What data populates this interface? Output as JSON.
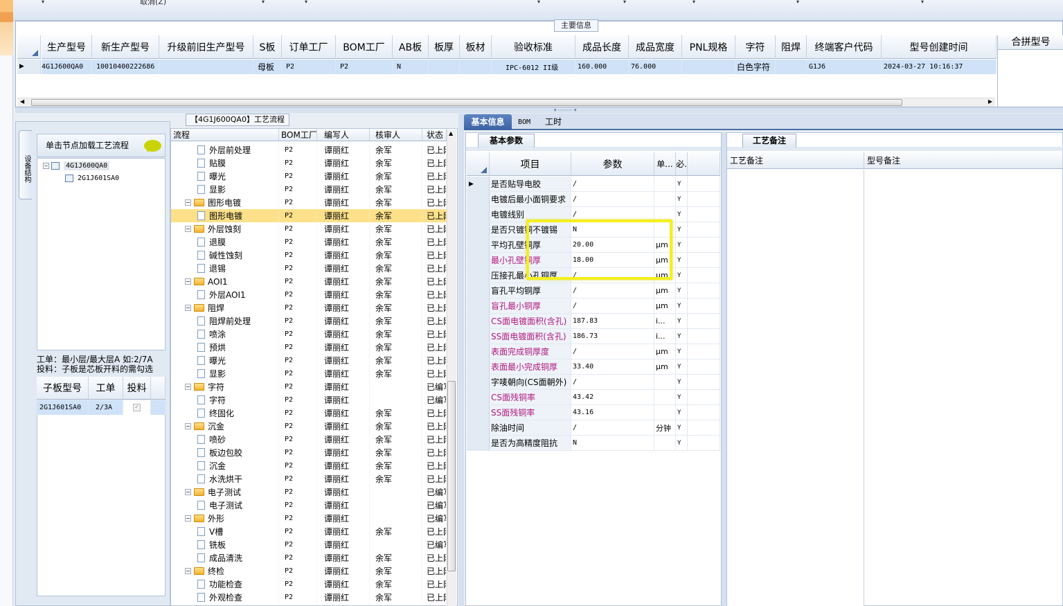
{
  "toolbar": {
    "cancel_label": "取消(Z)"
  },
  "main_info": {
    "title": "主要信息",
    "columns": [
      "生产型号",
      "新生产型号",
      "升级前旧生产型号",
      "S板",
      "订单工厂",
      "BOM工厂",
      "AB板",
      "板厚",
      "板材",
      "验收标准",
      "成品长度",
      "成品宽度",
      "PNL规格",
      "字符",
      "阻焊",
      "终端客户代码",
      "型号创建时间"
    ],
    "row": [
      "4G1J600QA0",
      "10010400222686",
      "",
      "母板",
      "P2",
      "P2",
      "N",
      "",
      "",
      "IPC-6012 II级",
      "160.000",
      "76.000",
      "",
      "白色字符",
      "",
      "G1J6",
      "2024-03-27 10:16:37"
    ],
    "merge_header": "合拼型号"
  },
  "structure": {
    "tab_label": "设备结构",
    "load_header": "单击节点加载工艺流程",
    "tree": [
      {
        "label": "4G1J600QA0",
        "level": 0
      },
      {
        "label": "2G1J601SA0",
        "level": 1
      }
    ],
    "hint_line1": "工单：最小层/最大层A 如:2/7A",
    "hint_line2": "投料：子板是芯板开料的需勾选",
    "sub_columns": [
      "子板型号",
      "工单",
      "投料"
    ],
    "sub_row": {
      "model": "2G1J601SA0",
      "order": "2/3A",
      "checked": "✓"
    }
  },
  "process": {
    "title": "【4G1J600QA0】工艺流程",
    "columns": [
      "流程",
      "BOM工厂",
      "编写人",
      "核审人",
      "状态"
    ],
    "rows": [
      {
        "level": 1,
        "type": "doc",
        "name": "外层前处理",
        "factory": "P2",
        "writer": "谭丽红",
        "reviewer": "余军",
        "status": "已上网"
      },
      {
        "level": 1,
        "type": "doc",
        "name": "贴膜",
        "factory": "P2",
        "writer": "谭丽红",
        "reviewer": "余军",
        "status": "已上网"
      },
      {
        "level": 1,
        "type": "doc",
        "name": "曝光",
        "factory": "P2",
        "writer": "谭丽红",
        "reviewer": "余军",
        "status": "已上网"
      },
      {
        "level": 1,
        "type": "doc",
        "name": "显影",
        "factory": "P2",
        "writer": "谭丽红",
        "reviewer": "余军",
        "status": "已上网"
      },
      {
        "level": 0,
        "type": "folder",
        "name": "图形电镀",
        "factory": "P2",
        "writer": "谭丽红",
        "reviewer": "余军",
        "status": "已上网"
      },
      {
        "level": 1,
        "type": "doc",
        "name": "图形电镀",
        "factory": "P2",
        "writer": "谭丽红",
        "reviewer": "余军",
        "status": "已上网",
        "selected": true
      },
      {
        "level": 0,
        "type": "folder",
        "name": "外层蚀刻",
        "factory": "P2",
        "writer": "谭丽红",
        "reviewer": "余军",
        "status": "已上网"
      },
      {
        "level": 1,
        "type": "doc",
        "name": "退膜",
        "factory": "P2",
        "writer": "谭丽红",
        "reviewer": "余军",
        "status": "已上网"
      },
      {
        "level": 1,
        "type": "doc",
        "name": "碱性蚀刻",
        "factory": "P2",
        "writer": "谭丽红",
        "reviewer": "余军",
        "status": "已上网"
      },
      {
        "level": 1,
        "type": "doc",
        "name": "退锡",
        "factory": "P2",
        "writer": "谭丽红",
        "reviewer": "余军",
        "status": "已上网"
      },
      {
        "level": 0,
        "type": "folder",
        "name": "AOI1",
        "factory": "P2",
        "writer": "谭丽红",
        "reviewer": "余军",
        "status": "已上网"
      },
      {
        "level": 1,
        "type": "doc",
        "name": "外层AOI1",
        "factory": "P2",
        "writer": "谭丽红",
        "reviewer": "余军",
        "status": "已上网"
      },
      {
        "level": 0,
        "type": "folder",
        "name": "阻焊",
        "factory": "P2",
        "writer": "谭丽红",
        "reviewer": "余军",
        "status": "已上网"
      },
      {
        "level": 1,
        "type": "doc",
        "name": "阻焊前处理",
        "factory": "P2",
        "writer": "谭丽红",
        "reviewer": "余军",
        "status": "已上网"
      },
      {
        "level": 1,
        "type": "doc",
        "name": "喷涂",
        "factory": "P2",
        "writer": "谭丽红",
        "reviewer": "余军",
        "status": "已上网"
      },
      {
        "level": 1,
        "type": "doc",
        "name": "预烘",
        "factory": "P2",
        "writer": "谭丽红",
        "reviewer": "余军",
        "status": "已上网"
      },
      {
        "level": 1,
        "type": "doc",
        "name": "曝光",
        "factory": "P2",
        "writer": "谭丽红",
        "reviewer": "余军",
        "status": "已上网"
      },
      {
        "level": 1,
        "type": "doc",
        "name": "显影",
        "factory": "P2",
        "writer": "谭丽红",
        "reviewer": "余军",
        "status": "已上网"
      },
      {
        "level": 0,
        "type": "folder",
        "name": "字符",
        "factory": "P2",
        "writer": "谭丽红",
        "reviewer": "",
        "status": "已编写"
      },
      {
        "level": 1,
        "type": "doc",
        "name": "字符",
        "factory": "P2",
        "writer": "谭丽红",
        "reviewer": "",
        "status": "已编写"
      },
      {
        "level": 1,
        "type": "doc",
        "name": "终固化",
        "factory": "P2",
        "writer": "谭丽红",
        "reviewer": "余军",
        "status": "已上网"
      },
      {
        "level": 0,
        "type": "folder",
        "name": "沉金",
        "factory": "P2",
        "writer": "谭丽红",
        "reviewer": "余军",
        "status": "已上网"
      },
      {
        "level": 1,
        "type": "doc",
        "name": "喷砂",
        "factory": "P2",
        "writer": "谭丽红",
        "reviewer": "余军",
        "status": "已上网"
      },
      {
        "level": 1,
        "type": "doc",
        "name": "板边包胶",
        "factory": "P2",
        "writer": "谭丽红",
        "reviewer": "余军",
        "status": "已上网"
      },
      {
        "level": 1,
        "type": "doc",
        "name": "沉金",
        "factory": "P2",
        "writer": "谭丽红",
        "reviewer": "余军",
        "status": "已上网"
      },
      {
        "level": 1,
        "type": "doc",
        "name": "水洗烘干",
        "factory": "P2",
        "writer": "谭丽红",
        "reviewer": "余军",
        "status": "已上网"
      },
      {
        "level": 0,
        "type": "folder",
        "name": "电子测试",
        "factory": "P2",
        "writer": "谭丽红",
        "reviewer": "",
        "status": "已编写"
      },
      {
        "level": 1,
        "type": "doc",
        "name": "电子测试",
        "factory": "P2",
        "writer": "谭丽红",
        "reviewer": "",
        "status": "已编写"
      },
      {
        "level": 0,
        "type": "folder",
        "name": "外形",
        "factory": "P2",
        "writer": "谭丽红",
        "reviewer": "",
        "status": "已编写"
      },
      {
        "level": 1,
        "type": "doc",
        "name": "V槽",
        "factory": "P2",
        "writer": "谭丽红",
        "reviewer": "余军",
        "status": "已上网"
      },
      {
        "level": 1,
        "type": "doc",
        "name": "铣板",
        "factory": "P2",
        "writer": "谭丽红",
        "reviewer": "",
        "status": "已编写"
      },
      {
        "level": 1,
        "type": "doc",
        "name": "成品清洗",
        "factory": "P2",
        "writer": "谭丽红",
        "reviewer": "余军",
        "status": "已上网"
      },
      {
        "level": 0,
        "type": "folder",
        "name": "终检",
        "factory": "P2",
        "writer": "谭丽红",
        "reviewer": "余军",
        "status": "已上网"
      },
      {
        "level": 1,
        "type": "doc",
        "name": "功能检查",
        "factory": "P2",
        "writer": "谭丽红",
        "reviewer": "余军",
        "status": "已上网"
      },
      {
        "level": 1,
        "type": "doc",
        "name": "外观检查",
        "factory": "P2",
        "writer": "谭丽红",
        "reviewer": "余军",
        "status": "已上网"
      }
    ]
  },
  "right_tabs": [
    "基本信息",
    "BOM",
    "工时"
  ],
  "basic_params": {
    "title": "基本参数",
    "columns": [
      "项目",
      "参数",
      "单...",
      "必."
    ],
    "rows": [
      {
        "item": "是否贴导电胶",
        "value": "/",
        "unit": "",
        "req": "Y",
        "pink": false
      },
      {
        "item": "电镀后最小面铜要求",
        "value": "/",
        "unit": "",
        "req": "Y",
        "pink": false
      },
      {
        "item": "电镀线别",
        "value": "/",
        "unit": "",
        "req": "Y",
        "pink": false
      },
      {
        "item": "是否只镀铜不镀锡",
        "value": "N",
        "unit": "",
        "req": "Y",
        "pink": false
      },
      {
        "item": "平均孔壁铜厚",
        "value": "20.00",
        "unit": "μm",
        "req": "Y",
        "pink": false
      },
      {
        "item": "最小孔壁铜厚",
        "value": "18.00",
        "unit": "μm",
        "req": "Y",
        "pink": true
      },
      {
        "item": "压接孔最小孔铜厚",
        "value": "/",
        "unit": "μm",
        "req": "Y",
        "pink": false
      },
      {
        "item": "盲孔平均铜厚",
        "value": "/",
        "unit": "μm",
        "req": "Y",
        "pink": false
      },
      {
        "item": "盲孔最小铜厚",
        "value": "/",
        "unit": "μm",
        "req": "Y",
        "pink": true
      },
      {
        "item": "CS面电镀面积(含孔)",
        "value": "187.83",
        "unit": "i...",
        "req": "Y",
        "pink": true
      },
      {
        "item": "SS面电镀面积(含孔)",
        "value": "186.73",
        "unit": "i...",
        "req": "Y",
        "pink": true
      },
      {
        "item": "表面完成铜厚度",
        "value": "/",
        "unit": "μm",
        "req": "Y",
        "pink": true
      },
      {
        "item": "表面最小完成铜厚",
        "value": "33.40",
        "unit": "μm",
        "req": "Y",
        "pink": true
      },
      {
        "item": "字唛朝向(CS面朝外)",
        "value": "/",
        "unit": "",
        "req": "Y",
        "pink": false
      },
      {
        "item": "CS面残铜率",
        "value": "43.42",
        "unit": "",
        "req": "Y",
        "pink": true
      },
      {
        "item": "SS面残铜率",
        "value": "43.16",
        "unit": "",
        "req": "Y",
        "pink": true
      },
      {
        "item": "除油时间",
        "value": "/",
        "unit": "分钟",
        "req": "Y",
        "pink": false
      },
      {
        "item": "是否为高精度阻抗",
        "value": "N",
        "unit": "",
        "req": "Y",
        "pink": false
      }
    ]
  },
  "remarks": {
    "title": "工艺备注",
    "columns": [
      "工艺备注",
      "型号备注"
    ]
  },
  "colors": {
    "selection": "#cfe2f8",
    "tree_selected": "#fde18a",
    "highlight": "#f4ef1e",
    "required_label": "#b0197f",
    "active_tab": "#3c62a2"
  }
}
